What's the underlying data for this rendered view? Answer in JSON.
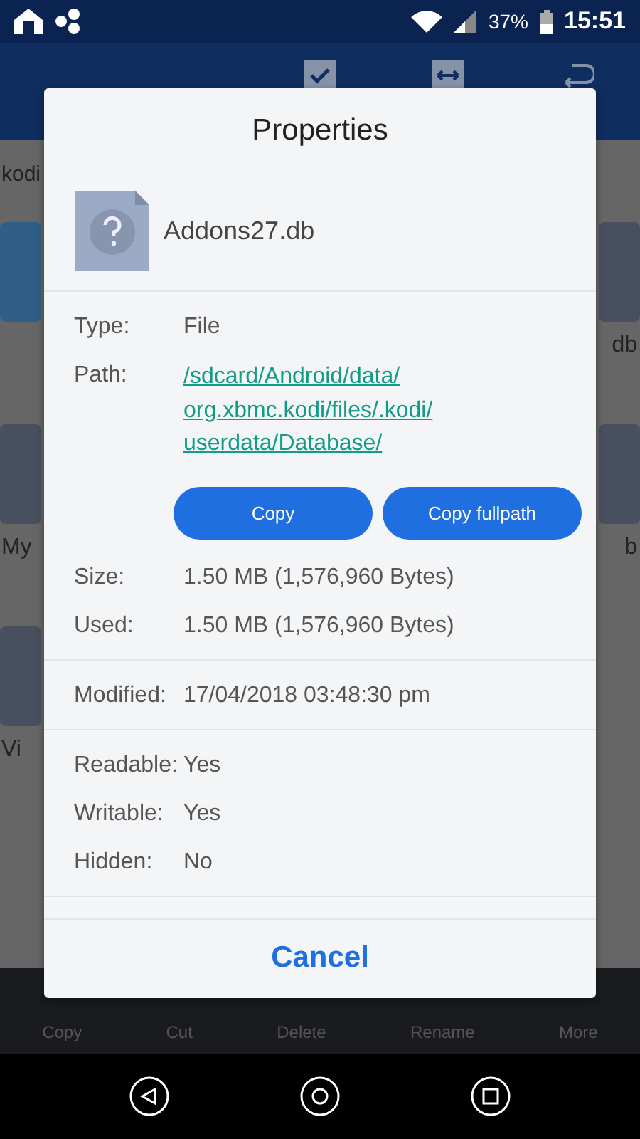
{
  "status_bar": {
    "battery": "37%",
    "time": "15:51"
  },
  "background": {
    "breadcrumb": "kodi",
    "rows": [
      {
        "left": {
          "kind": "folder"
        },
        "right": {
          "kind": "file",
          "label": "db"
        }
      },
      {
        "left": {
          "kind": "file",
          "label": "My"
        },
        "right": {
          "kind": "file",
          "label": "b"
        }
      },
      {
        "left": {
          "kind": "file",
          "label": "Vi"
        },
        "right": null
      }
    ],
    "toolbar": [
      "Copy",
      "Cut",
      "Delete",
      "Rename",
      "More"
    ]
  },
  "dialog": {
    "title": "Properties",
    "file_name": "Addons27.db",
    "sections": [
      {
        "rows": [
          {
            "label": "Type:",
            "value": "File",
            "kind": "text"
          },
          {
            "label": "Path:",
            "value": "/sdcard/Android/data/ org.xbmc.kodi/files/.kodi/ userdata/Database/",
            "kind": "link"
          },
          {
            "kind": "buttons",
            "buttons": [
              "Copy",
              "Copy fullpath"
            ]
          },
          {
            "label": "Size:",
            "value": "1.50 MB (1,576,960 Bytes)",
            "kind": "text"
          },
          {
            "label": "Used:",
            "value": "1.50 MB (1,576,960 Bytes)",
            "kind": "text"
          }
        ]
      },
      {
        "rows": [
          {
            "label": "Modified:",
            "value": "17/04/2018 03:48:30 pm",
            "kind": "text"
          }
        ]
      },
      {
        "rows": [
          {
            "label": "Readable:",
            "value": "Yes",
            "kind": "text"
          },
          {
            "label": "Writable:",
            "value": "Yes",
            "kind": "text"
          },
          {
            "label": "Hidden:",
            "value": "No",
            "kind": "text"
          }
        ]
      }
    ],
    "cancel": "Cancel"
  }
}
